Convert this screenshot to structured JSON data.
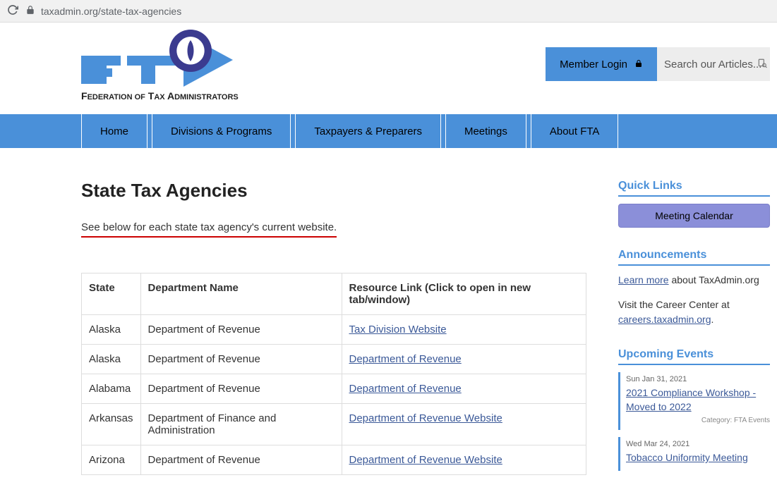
{
  "browser": {
    "url": "taxadmin.org/state-tax-agencies"
  },
  "header": {
    "logo_top": "FTA",
    "logo_bottom": "Federation of Tax Administrators",
    "login_label": "Member Login",
    "search_placeholder": "Search our Articles..."
  },
  "nav": {
    "items": [
      "Home",
      "Divisions & Programs",
      "Taxpayers & Preparers",
      "Meetings",
      "About FTA"
    ]
  },
  "main": {
    "title": "State Tax Agencies",
    "subtitle": "See below for each state tax agency's current website.",
    "columns": [
      "State",
      "Department Name",
      "Resource Link (Click to open in new tab/window)"
    ],
    "rows": [
      {
        "state": "Alaska",
        "dept": "Department of Revenue",
        "link": "Tax Division Website"
      },
      {
        "state": "Alaska",
        "dept": "Department of Revenue",
        "link": "Department of Revenue"
      },
      {
        "state": "Alabama",
        "dept": "Department of Revenue",
        "link": "Department of Revenue"
      },
      {
        "state": "Arkansas",
        "dept": "Department of Finance and Administration",
        "link": "Department of Revenue Website"
      },
      {
        "state": "Arizona",
        "dept": "Department of Revenue",
        "link": "Department of Revenue Website"
      }
    ]
  },
  "sidebar": {
    "quick_links": {
      "heading": "Quick Links",
      "calendar_btn": "Meeting Calendar"
    },
    "announcements": {
      "heading": "Announcements",
      "learn_more": "Learn more",
      "learn_more_tail": " about TaxAdmin.org",
      "career_pre": "Visit the Career Center at ",
      "career_link": "careers.taxadmin.org",
      "career_tail": "."
    },
    "events": {
      "heading": "Upcoming Events",
      "items": [
        {
          "date": "Sun Jan 31, 2021",
          "title": "2021 Compliance Workshop - Moved to 2022",
          "category": "Category: FTA Events"
        },
        {
          "date": "Wed Mar 24, 2021",
          "title": "Tobacco Uniformity Meeting",
          "category": ""
        }
      ]
    }
  }
}
